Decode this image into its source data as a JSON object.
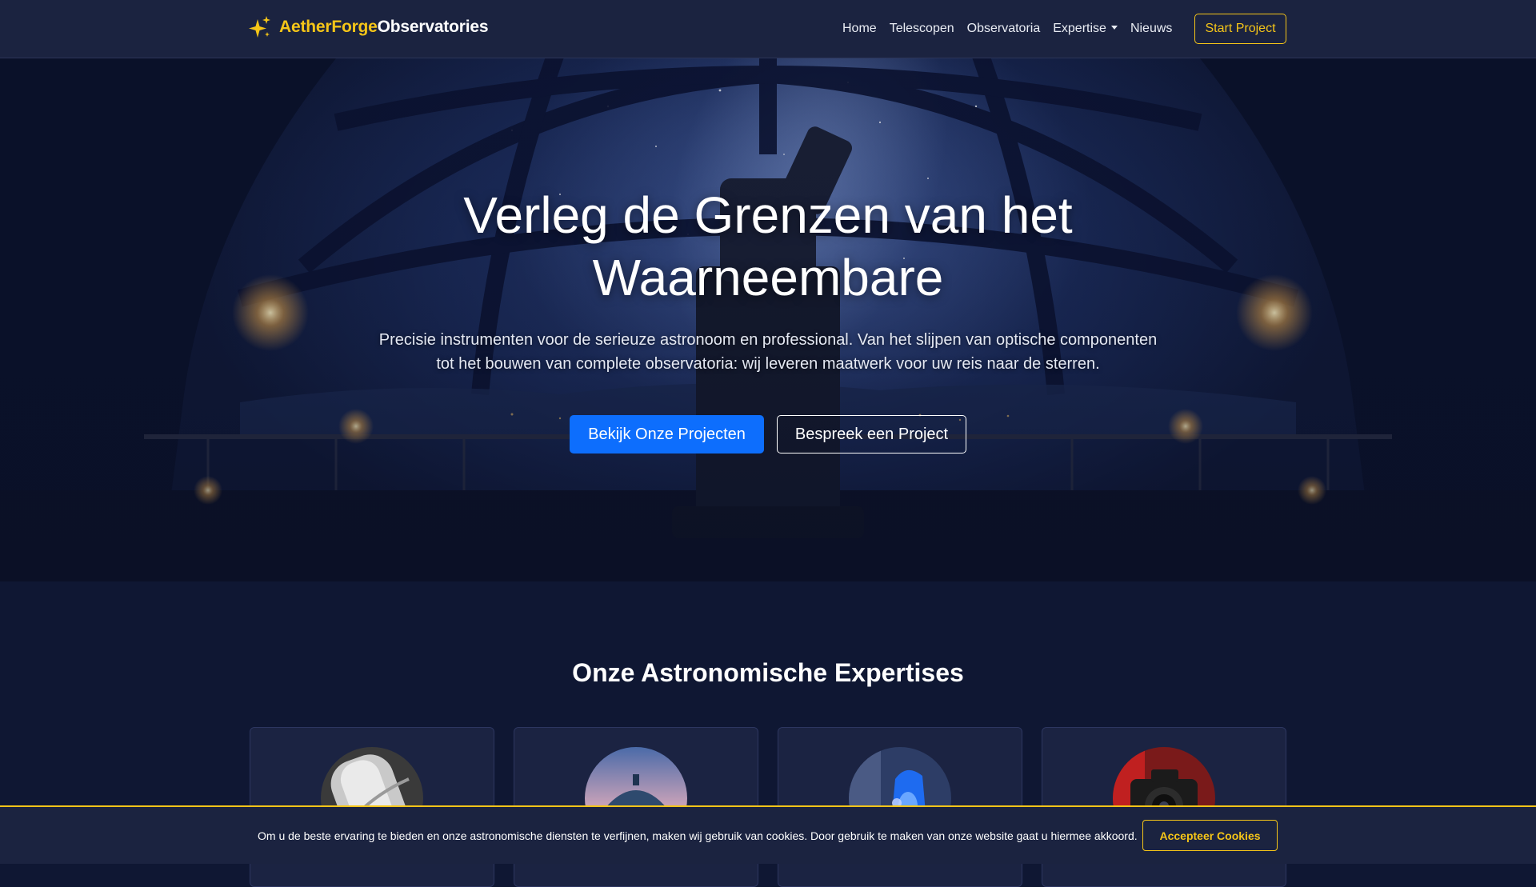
{
  "navbar": {
    "brand_accent": "AetherForge",
    "brand_rest": "Observatories",
    "brand_icon": "sparkles-icon",
    "links": [
      {
        "label": "Home"
      },
      {
        "label": "Telescopen"
      },
      {
        "label": "Observatoria"
      },
      {
        "label": "Expertise"
      },
      {
        "label": "Nieuws"
      }
    ],
    "cta_label": "Start Project"
  },
  "hero": {
    "title": "Verleg de Grenzen van het Waarneembare",
    "subtitle": "Precisie instrumenten voor de serieuze astronoom en professional. Van het slijpen van optische componenten tot het bouwen van complete observatoria: wij leveren maatwerk voor uw reis naar de sterren.",
    "primary_button": "Bekijk Onze Projecten",
    "secondary_button": "Bespreek een Project"
  },
  "expertise": {
    "title": "Onze Astronomische Expertises",
    "cards": [
      {
        "image": "telescope-optics-image"
      },
      {
        "image": "observatory-dome-image"
      },
      {
        "image": "optics-lab-image"
      },
      {
        "image": "astro-camera-image"
      }
    ]
  },
  "cookie": {
    "text": "Om u de beste ervaring te bieden en onze astronomische diensten te verfijnen, maken wij gebruik van cookies. Door gebruik te maken van onze website gaat u hiermee akkoord.",
    "accept_label": "Accepteer Cookies"
  },
  "colors": {
    "accent": "#f5c518",
    "primary": "#0d6efd",
    "navbar_bg": "#1b2340",
    "page_bg": "#0f1733"
  }
}
